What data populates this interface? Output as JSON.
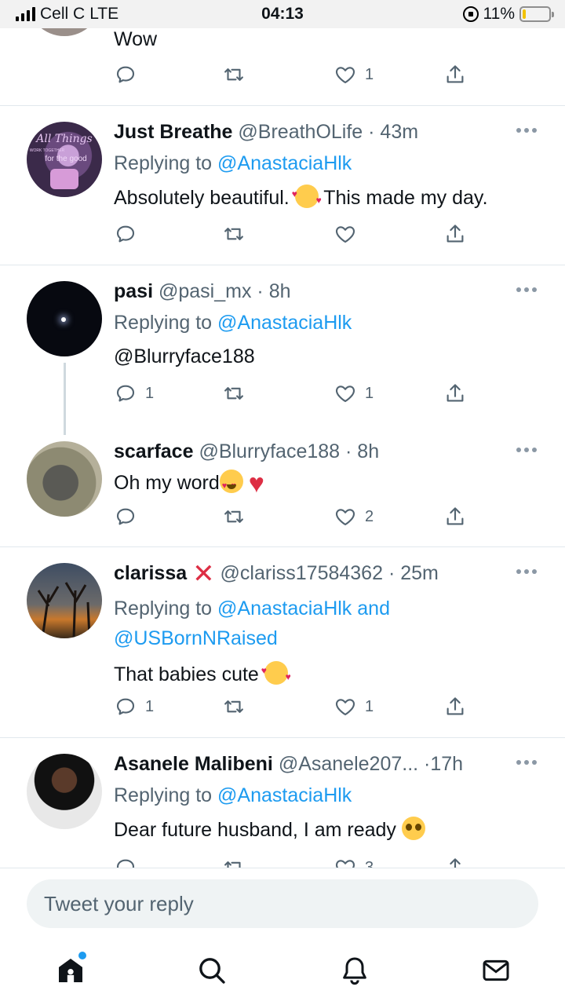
{
  "status_bar": {
    "carrier": "Cell C",
    "network": "LTE",
    "time": "04:13",
    "battery": "11%"
  },
  "tweets": [
    {
      "text": "Wow",
      "likes": "1"
    },
    {
      "name": "Just Breathe",
      "handle": "@BreathOLife",
      "time": "· 43m",
      "replying_prefix": "Replying to",
      "replying_to": "@AnastaciaHlk",
      "text_a": "Absolutely beautiful. ",
      "text_b": " This made my day."
    },
    {
      "name": "pasi",
      "handle": "@pasi_mx",
      "time": "· 8h",
      "replying_prefix": "Replying to",
      "replying_to": "@AnastaciaHlk",
      "text": "@Blurryface188",
      "replies": "1",
      "likes": "1"
    },
    {
      "name": "scarface",
      "handle": "@Blurryface188",
      "time": "· 8h",
      "text": "Oh my word",
      "likes": "2"
    },
    {
      "name": "clarissa",
      "handle": "@clariss17584362",
      "time": "· 25m",
      "replying_prefix": "Replying to",
      "replying_to": "@AnastaciaHlk",
      "replying_and": "and",
      "replying_to_2": "@USBornNRaised",
      "text": "That babies cute ",
      "replies": "1",
      "likes": "1"
    },
    {
      "name": "Asanele Malibeni",
      "handle": "@Asanele207...",
      "time": "·17h",
      "replying_prefix": "Replying to",
      "replying_to": "@AnastaciaHlk",
      "text": "Dear future husband, I am ready ",
      "likes": "3"
    }
  ],
  "avatar_text": {
    "line1": "All Things",
    "line2": "WORK TOGETHER",
    "line3": "for the good"
  },
  "composer": {
    "placeholder": "Tweet your reply"
  },
  "icons": {
    "reply": "reply-icon",
    "retweet": "retweet-icon",
    "like": "heart-icon",
    "share": "share-icon",
    "more": "more-icon"
  },
  "colors": {
    "accent": "#1d9bf0",
    "secondary_text": "#536471",
    "divider": "#e1e8ed"
  }
}
